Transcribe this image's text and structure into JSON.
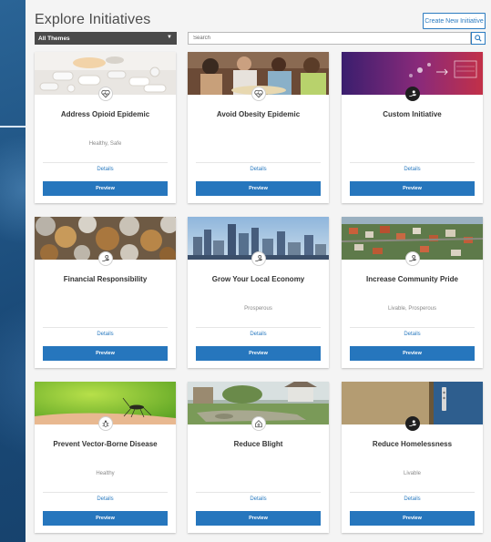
{
  "header": {
    "title": "Explore Initiatives",
    "create_label": "Create New Initiative"
  },
  "filters": {
    "theme_selected": "All Themes",
    "search_placeholder": "Search"
  },
  "colors": {
    "accent": "#2676bd",
    "panel": "#f4f4f4",
    "backdrop": "#1d4f7c"
  },
  "cards": [
    {
      "title": "Address Opioid Epidemic",
      "tags": "Healthy, Safe",
      "details": "Details",
      "preview": "Preview",
      "icon": "heart-pulse-icon"
    },
    {
      "title": "Avoid Obesity Epidemic",
      "tags": "",
      "details": "Details",
      "preview": "Preview",
      "icon": "heart-pulse-icon"
    },
    {
      "title": "Custom Initiative",
      "tags": "",
      "details": "Details",
      "preview": "Preview",
      "icon": "hand-care-icon"
    },
    {
      "title": "Financial Responsibility",
      "tags": "",
      "details": "Details",
      "preview": "Preview",
      "icon": "hand-money-icon"
    },
    {
      "title": "Grow Your Local Economy",
      "tags": "Prosperous",
      "details": "Details",
      "preview": "Preview",
      "icon": "hand-money-icon"
    },
    {
      "title": "Increase Community Pride",
      "tags": "Livable, Prosperous",
      "details": "Details",
      "preview": "Preview",
      "icon": "hand-money-icon"
    },
    {
      "title": "Prevent Vector-Borne Disease",
      "tags": "Healthy",
      "details": "Details",
      "preview": "Preview",
      "icon": "bug-icon"
    },
    {
      "title": "Reduce Blight",
      "tags": "",
      "details": "Details",
      "preview": "Preview",
      "icon": "house-icon"
    },
    {
      "title": "Reduce Homelessness",
      "tags": "Livable",
      "details": "Details",
      "preview": "Preview",
      "icon": "hand-care-icon"
    }
  ]
}
